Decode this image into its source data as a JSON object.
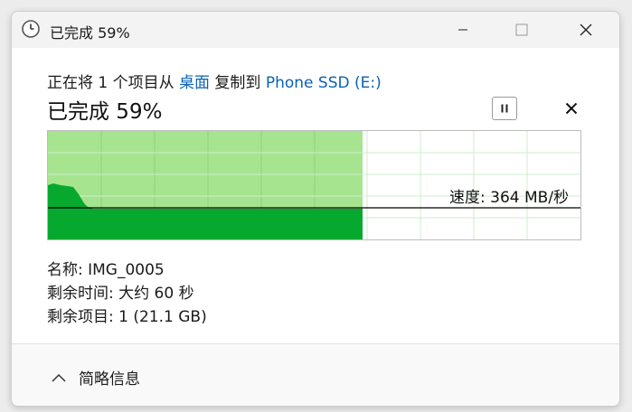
{
  "window": {
    "title": "已完成 59%",
    "accent_color": "#0a62b5"
  },
  "copy": {
    "prefix": "正在将 1 个项目从 ",
    "source": "桌面",
    "middle": " 复制到 ",
    "destination": "Phone SSD (E:)"
  },
  "progress": {
    "heading": "已完成 59%",
    "percent": 59,
    "speed_label": "速度: 364 MB/秒",
    "fill_color": "#a6e48f",
    "speed_color": "#06a82e",
    "pause_icon": "pause-icon",
    "close_icon": "close-icon"
  },
  "details": {
    "name": "名称: IMG_0005",
    "time_remaining": "剩余时间: 大约 60 秒",
    "items_remaining": "剩余项目: 1 (21.1 GB)"
  },
  "footer": {
    "toggle_label": "简略信息",
    "toggle_icon": "chevron-up-icon"
  }
}
